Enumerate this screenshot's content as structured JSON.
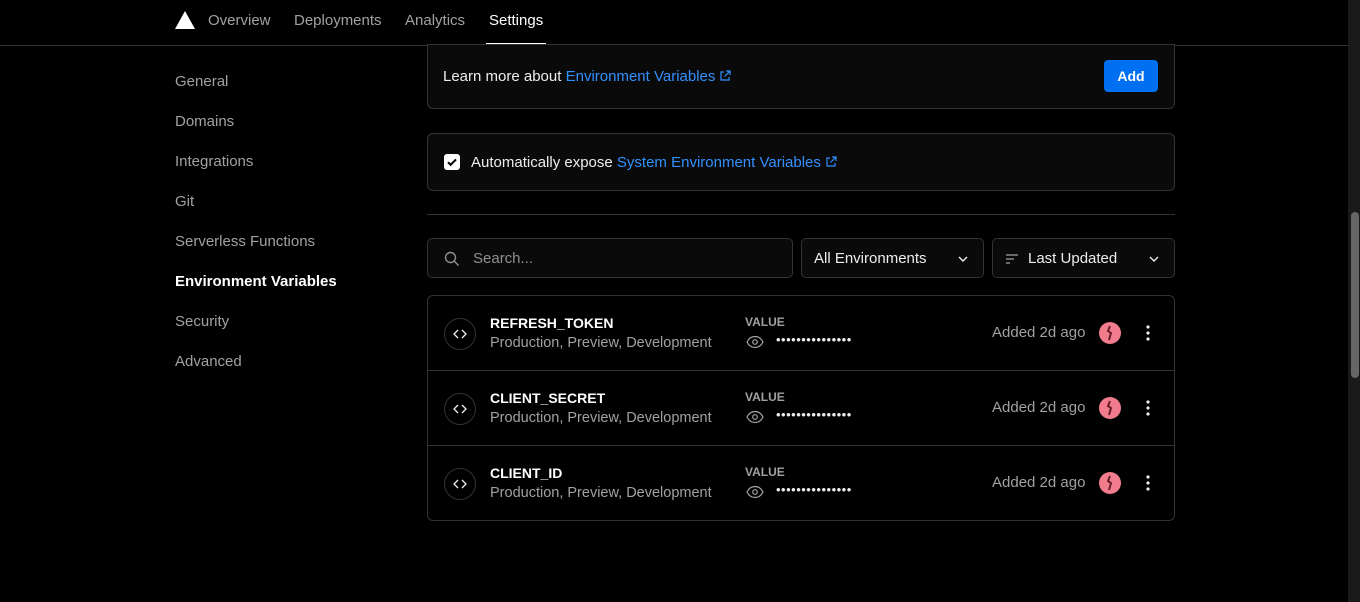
{
  "nav": {
    "tabs": [
      {
        "label": "Overview"
      },
      {
        "label": "Deployments"
      },
      {
        "label": "Analytics"
      },
      {
        "label": "Settings"
      }
    ]
  },
  "sidebar": {
    "items": [
      {
        "label": "General"
      },
      {
        "label": "Domains"
      },
      {
        "label": "Integrations"
      },
      {
        "label": "Git"
      },
      {
        "label": "Serverless Functions"
      },
      {
        "label": "Environment Variables"
      },
      {
        "label": "Security"
      },
      {
        "label": "Advanced"
      }
    ],
    "active": "Environment Variables"
  },
  "learn": {
    "prefix": "Learn more about",
    "link": "Environment Variables",
    "add_label": "Add"
  },
  "expose": {
    "checked": true,
    "prefix": "Automatically expose",
    "link": "System Environment Variables"
  },
  "filters": {
    "search_placeholder": "Search...",
    "environment": "All Environments",
    "sort": "Last Updated"
  },
  "env_vars": [
    {
      "name": "REFRESH_TOKEN",
      "targets": "Production, Preview, Development",
      "value_label": "VALUE",
      "masked": "•••••••••••••••",
      "added": "Added 2d ago"
    },
    {
      "name": "CLIENT_SECRET",
      "targets": "Production, Preview, Development",
      "value_label": "VALUE",
      "masked": "•••••••••••••••",
      "added": "Added 2d ago"
    },
    {
      "name": "CLIENT_ID",
      "targets": "Production, Preview, Development",
      "value_label": "VALUE",
      "masked": "•••••••••••••••",
      "added": "Added 2d ago"
    }
  ],
  "colors": {
    "accent": "#0070f3",
    "link": "#3291ff",
    "avatar": "#f07c8e"
  },
  "icons": [
    "triangle-logo-icon",
    "external-link-icon",
    "check-icon",
    "search-icon",
    "chevron-down-icon",
    "sort-lines-icon",
    "code-icon",
    "eye-icon",
    "more-vertical-icon"
  ]
}
